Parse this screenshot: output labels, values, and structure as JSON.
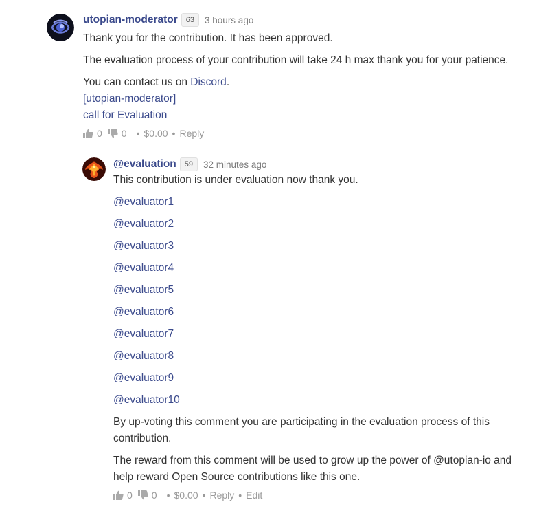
{
  "comments": [
    {
      "author": "utopian-moderator",
      "reputation": "63",
      "time": "3 hours ago",
      "line1": "Thank you for the contribution. It has been approved.",
      "line2": "The evaluation process of your contribution will take 24 h max thank you for your patience.",
      "contact_prefix": "You can contact us on ",
      "contact_link": "Discord",
      "contact_suffix": ".",
      "tag_link": "[utopian-moderator]",
      "eval_link": "call for Evaluation",
      "upvotes": "0",
      "downvotes": "0",
      "payout": "$0.00",
      "reply": "Reply"
    },
    {
      "author": "@evaluation",
      "reputation": "59",
      "time": "32 minutes ago",
      "line1": "This contribution is under evaluation now thank you.",
      "mentions": [
        "@evaluator1",
        "@evaluator2",
        "@evaluator3",
        "@evaluator4",
        "@evaluator5",
        "@evaluator6",
        "@evaluator7",
        "@evaluator8",
        "@evaluator9",
        "@evaluator10"
      ],
      "para1": "By up-voting this comment you are participating in the evaluation process of this contribution.",
      "para2": "The reward from this comment will be used to grow up the power of @utopian-io and help reward Open Source contributions like this one.",
      "upvotes": "0",
      "downvotes": "0",
      "payout": "$0.00",
      "reply": "Reply",
      "edit": "Edit"
    }
  ],
  "icons": {
    "upvote": "thumbs-up-icon",
    "downvote": "thumbs-down-icon"
  }
}
